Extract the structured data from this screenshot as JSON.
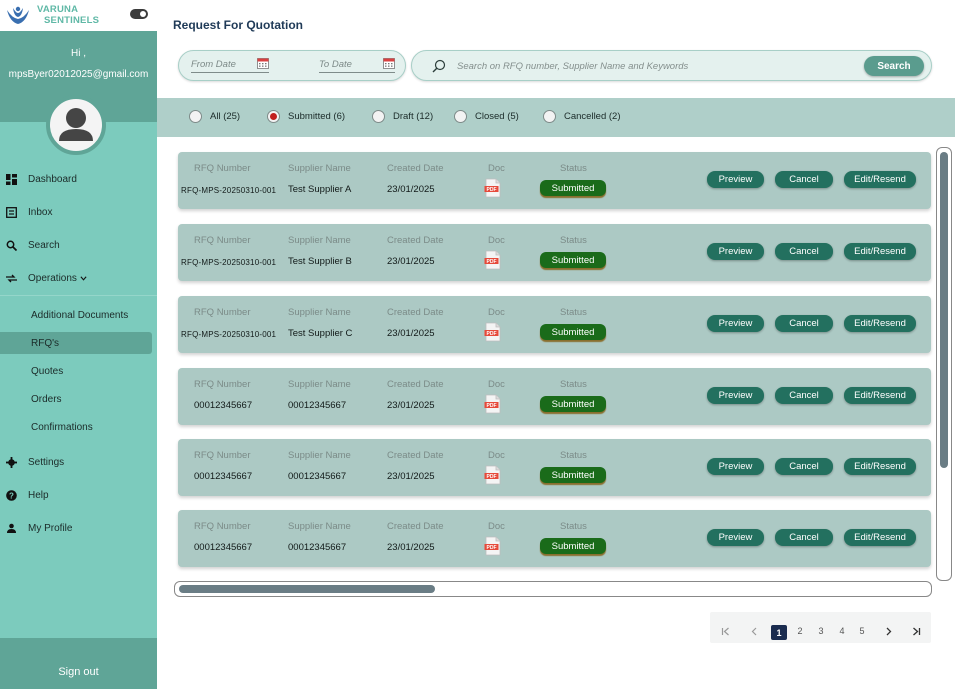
{
  "brand": {
    "line1": "VARUNA",
    "line2": "SENTINELS"
  },
  "user": {
    "greeting": "Hi ,",
    "email": "mpsByer02012025@gmail.com"
  },
  "nav": {
    "dashboard": "Dashboard",
    "inbox": "Inbox",
    "search": "Search",
    "operations": "Operations",
    "settings": "Settings",
    "help": "Help",
    "profile": "My Profile",
    "signout": "Sign out"
  },
  "operations_sub": [
    "Additional Documents",
    "RFQ's",
    "Quotes",
    "Orders",
    "Confirmations"
  ],
  "page": {
    "title": "Request For Quotation"
  },
  "filters": {
    "from_placeholder": "From Date",
    "to_placeholder": "To Date",
    "search_placeholder": "Search on RFQ number, Supplier Name and Keywords",
    "search_button": "Search"
  },
  "status_filters": [
    {
      "label": "All (25)",
      "checked": false
    },
    {
      "label": "Submitted (6)",
      "checked": true
    },
    {
      "label": "Draft (12)",
      "checked": false
    },
    {
      "label": "Closed (5)",
      "checked": false
    },
    {
      "label": "Cancelled (2)",
      "checked": false
    }
  ],
  "columns": {
    "rfq": "RFQ Number",
    "supplier": "Supplier Name",
    "created": "Created Date",
    "doc": "Doc",
    "status": "Status"
  },
  "doc_icon_text": "PDF",
  "actions": {
    "preview": "Preview",
    "cancel": "Cancel",
    "edit": "Edit/Resend"
  },
  "rows": [
    {
      "rfq": "RFQ-MPS-20250310-001",
      "supplier": "Test Supplier A",
      "created": "23/01/2025",
      "status": "Submitted"
    },
    {
      "rfq": "RFQ-MPS-20250310-001",
      "supplier": "Test Supplier B",
      "created": "23/01/2025",
      "status": "Submitted"
    },
    {
      "rfq": "RFQ-MPS-20250310-001",
      "supplier": "Test Supplier C",
      "created": "23/01/2025",
      "status": "Submitted"
    },
    {
      "rfq": "00012345667",
      "supplier": "00012345667",
      "created": "23/01/2025",
      "status": "Submitted"
    },
    {
      "rfq": "00012345667",
      "supplier": "00012345667",
      "created": "23/01/2025",
      "status": "Submitted"
    },
    {
      "rfq": "00012345667",
      "supplier": "00012345667",
      "created": "23/01/2025",
      "status": "Submitted"
    }
  ],
  "pagination": {
    "pages": [
      "1",
      "2",
      "3",
      "4",
      "5"
    ],
    "current": "1"
  },
  "colors": {
    "sidebar": "#7ccbbd",
    "sidebar_dark": "#5fa597",
    "card": "#acc9c4",
    "action": "#23705f",
    "status": "#1a6b1a",
    "title": "#1f3a57"
  }
}
